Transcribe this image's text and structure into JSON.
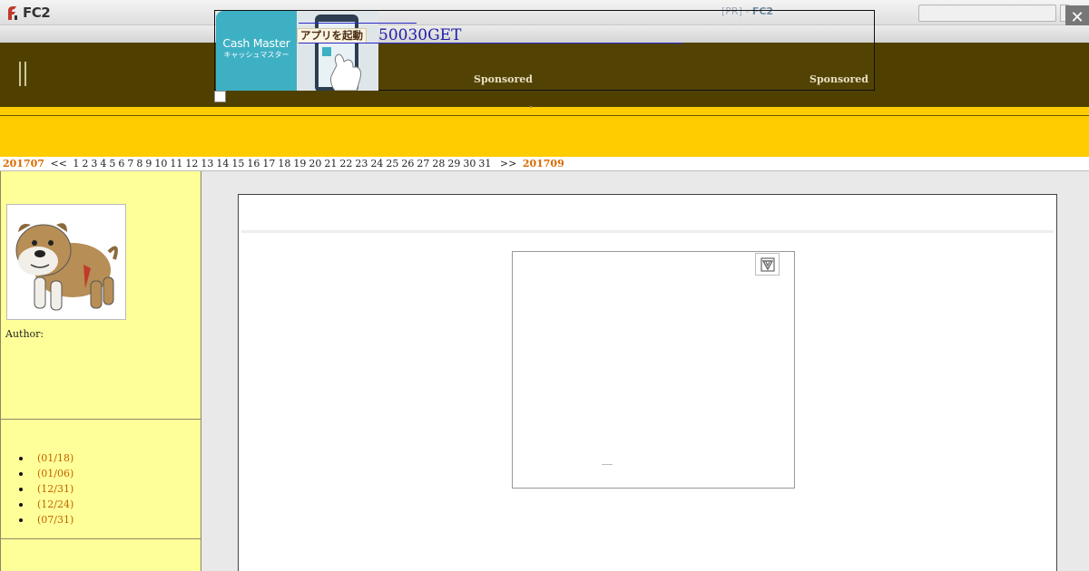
{
  "fc2_bar": {
    "logo_text": "FC2",
    "pr_label": "[PR]",
    "pr_separator": " - ",
    "pr_brand": "FC2",
    "close_glyph": "✕"
  },
  "overlay_ad": {
    "app_title": "Cash Master",
    "app_subtitle": "キャッシュマスター",
    "launch_badge": "アプリを起動",
    "headline": "50030GET",
    "sponsored_1": "Sponsored",
    "sponsored_2": "Sponsored"
  },
  "calendar": {
    "prev_month": "201707",
    "prev_arrow": "<<",
    "days": [
      "1",
      "2",
      "3",
      "4",
      "5",
      "6",
      "7",
      "8",
      "9",
      "10",
      "11",
      "12",
      "13",
      "14",
      "15",
      "16",
      "17",
      "18",
      "19",
      "20",
      "21",
      "22",
      "23",
      "24",
      "25",
      "26",
      "27",
      "28",
      "29",
      "30",
      "31"
    ],
    "next_arrow": ">>",
    "next_month": "201709"
  },
  "sidebar": {
    "author_label": "Author:",
    "recent_entries": [
      "(01/18)",
      "(01/06)",
      "(12/31)",
      "(12/24)",
      "(07/31)"
    ]
  },
  "icons": {
    "fc2_logo": "fc2-logo-icon",
    "close": "close-icon",
    "adchoices": "adchoices-icon",
    "avatar": "bulldog-avatar"
  },
  "colors": {
    "header_olive": "#4f4000",
    "accent_yellow": "#ffcc00",
    "sidebar_yellow": "#ffff99",
    "link_orange": "#d86a00",
    "app_icon_teal": "#3eb0c4"
  }
}
